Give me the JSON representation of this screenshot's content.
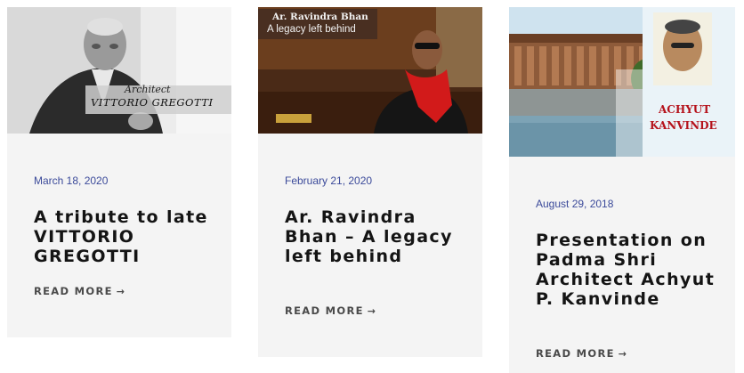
{
  "posts": [
    {
      "date": "March 18, 2020",
      "title": "A tribute to late VITTORIO GREGOTTI",
      "read_more": "READ MORE",
      "image_caption_small": "Architect",
      "image_caption_large": "VITTORIO GREGOTTI"
    },
    {
      "date": "February 21, 2020",
      "title": "Ar. Ravindra Bhan – A legacy left behind",
      "read_more": "READ MORE",
      "image_caption_small": "Ar. Ravindra Bhan",
      "image_caption_large": "A legacy left behind"
    },
    {
      "date": "August 29, 2018",
      "title": "Presentation on Padma Shri Architect Achyut P. Kanvinde",
      "read_more": "READ MORE",
      "image_caption_small": "ACHYUT",
      "image_caption_large": "KANVINDE"
    }
  ],
  "icons": {
    "read_more_arrow": "arrow-right-icon"
  },
  "colors": {
    "date": "#3b4a9a",
    "card_bg": "#f4f4f4",
    "title": "#141414",
    "caption_red": "#b5121b"
  }
}
